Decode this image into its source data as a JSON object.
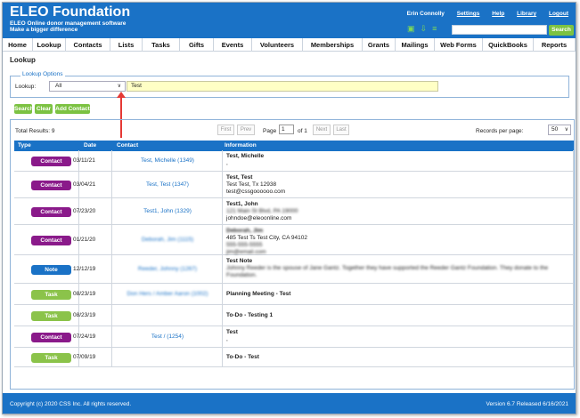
{
  "header": {
    "brand": "ELEO Foundation",
    "tagline1": "ELEO Online donor management software",
    "tagline2": "Make a bigger difference",
    "user": "Erin Connolly",
    "links": [
      "Settings",
      "Help",
      "Library",
      "Logout"
    ],
    "search_button": "Search",
    "icons": [
      "support-icon",
      "download-icon",
      "list-icon"
    ]
  },
  "nav": [
    "Home",
    "Lookup",
    "Contacts",
    "Lists",
    "Tasks",
    "Gifts",
    "Events",
    "Volunteers",
    "Memberships",
    "Grants",
    "Mailings",
    "Web Forms",
    "QuickBooks",
    "Reports"
  ],
  "page": {
    "title": "Lookup",
    "legend": "Lookup Options",
    "lookup_label": "Lookup:",
    "lookup_value": "All",
    "search_value": "Test",
    "buttons": [
      "Search",
      "Clear",
      "Add Contact"
    ]
  },
  "results": {
    "total": "Total Results: 9",
    "pagination": {
      "first": "First",
      "prev": "Prev",
      "page_label": "Page",
      "page": "1",
      "of": "of 1",
      "next": "Next",
      "last": "Last"
    },
    "records_label": "Records per page:",
    "records_value": "50",
    "columns": [
      "Type",
      "Date",
      "Contact",
      "Information"
    ],
    "rows": [
      {
        "type": "Contact",
        "color": "#8a1a8a",
        "date": "03/11/21",
        "contact": "Test, Michelle (1349)",
        "title": "Test, Michelle",
        "lines": [
          ","
        ]
      },
      {
        "type": "Contact",
        "color": "#8a1a8a",
        "date": "03/04/21",
        "contact": "Test, Test (1347)",
        "title": "Test, Test",
        "lines": [
          "Test Test, Tx 12938",
          "test@cssgoooooo.com"
        ]
      },
      {
        "type": "Contact",
        "color": "#8a1a8a",
        "date": "07/23/20",
        "contact": "Test1, John (1329)",
        "title": "Test1, John",
        "lines": [
          "121 Main St Blvd, PA 19000",
          "johndoe@eleoonline.com"
        ]
      },
      {
        "type": "Contact",
        "color": "#8a1a8a",
        "date": "01/21/20",
        "contact": "Deborah, Jim (1115)",
        "title": "Deborah, Jim",
        "lines": [
          "485 Test Ts Test City, CA 94102",
          "555-555-5555",
          "jim@email.com"
        ]
      },
      {
        "type": "Note",
        "color": "#1a72c6",
        "date": "12/12/19",
        "contact": "Reeder, Johnny (1267)",
        "title": "Test Note",
        "lines": [
          "Johnny Reeder is the spouse of Jane Gantz. Together they have supported the Reeder Gantz Foundation. They donate to the Foundation."
        ]
      },
      {
        "type": "Task",
        "color": "#8bc34a",
        "date": "08/23/19",
        "contact": "Don Hers / Amber Aaron (1002)",
        "title": "Planning Meeting - Test",
        "lines": []
      },
      {
        "type": "Task",
        "color": "#8bc34a",
        "date": "08/23/19",
        "contact": "",
        "title": "To-Do - Testing 1",
        "lines": []
      },
      {
        "type": "Contact",
        "color": "#8a1a8a",
        "date": "07/24/19",
        "contact": "Test / (1254)",
        "title": "Test",
        "lines": [
          ","
        ]
      },
      {
        "type": "Task",
        "color": "#8bc34a",
        "date": "07/09/19",
        "contact": "",
        "title": "To-Do - Test",
        "lines": []
      }
    ]
  },
  "footer": {
    "copyright": "Copyright (c) 2020 CSS Inc. All rights reserved.",
    "version": "Version 6.7 Released 6/16/2021"
  }
}
